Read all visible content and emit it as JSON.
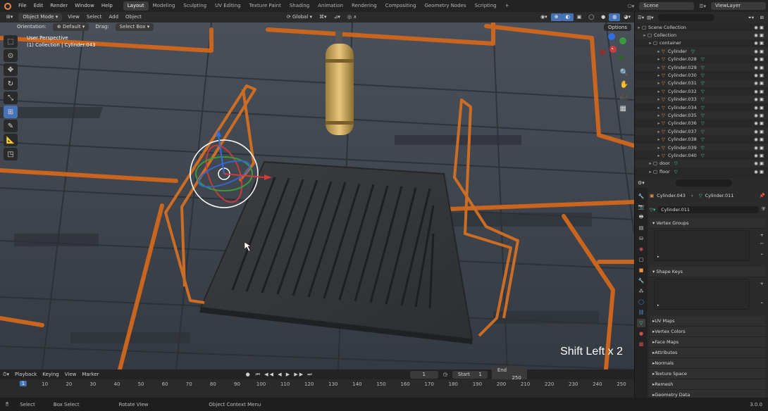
{
  "topbar": {
    "menus": [
      "File",
      "Edit",
      "Render",
      "Window",
      "Help"
    ],
    "workspaces": [
      "Layout",
      "Modeling",
      "Sculpting",
      "UV Editing",
      "Texture Paint",
      "Shading",
      "Animation",
      "Rendering",
      "Compositing",
      "Geometry Nodes",
      "Scripting"
    ],
    "active_workspace": "Layout",
    "add_tab": "+",
    "scene": "Scene",
    "view_layer": "ViewLayer"
  },
  "header": {
    "mode": "Object Mode",
    "menus": [
      "View",
      "Select",
      "Add",
      "Object"
    ],
    "transform": "Global",
    "orientation_label": "Orientation:",
    "orientation_value": "Default",
    "drag_label": "Drag:",
    "drag_value": "Select Box",
    "options": "Options"
  },
  "viewport": {
    "perspective": "User Perspective",
    "collection_info": "(1) Collection | Cylinder.043",
    "overlay_text": "Shift Left x 2"
  },
  "timeline": {
    "menus": [
      "Playback",
      "Keying",
      "View",
      "Marker"
    ],
    "current_frame": "1",
    "start_label": "Start",
    "start": "1",
    "end_label": "End",
    "end": "250",
    "ticks": [
      "1",
      "10",
      "20",
      "30",
      "40",
      "50",
      "60",
      "70",
      "80",
      "90",
      "100",
      "110",
      "120",
      "130",
      "140",
      "150",
      "160",
      "170",
      "180",
      "190",
      "200",
      "210",
      "220",
      "230",
      "240",
      "250"
    ]
  },
  "statusbar": {
    "items": [
      "Select",
      "Box Select",
      "Rotate View",
      "Object Context Menu"
    ],
    "version": "3.0.0"
  },
  "outliner": {
    "root": "Scene Collection",
    "collection": "Collection",
    "container": "container",
    "items": [
      "Cylinder",
      "Cylinder.028",
      "Cylinder.029",
      "Cylinder.030",
      "Cylinder.031",
      "Cylinder.032",
      "Cylinder.033",
      "Cylinder.034",
      "Cylinder.035",
      "Cylinder.036",
      "Cylinder.037",
      "Cylinder.038",
      "Cylinder.039",
      "Cylinder.040"
    ],
    "door": "door",
    "floor": "floor"
  },
  "properties": {
    "breadcrumb_object": "Cylinder.043",
    "breadcrumb_data": "Cylinder.011",
    "mesh_name": "Cylinder.011",
    "sections": {
      "vertex_groups": "Vertex Groups",
      "shape_keys": "Shape Keys",
      "collapsed": [
        "UV Maps",
        "Vertex Colors",
        "Face Maps",
        "Attributes",
        "Normals",
        "Texture Space",
        "Remesh",
        "Geometry Data"
      ]
    }
  },
  "colors": {
    "accent_blue": "#4772b3",
    "orange_pipe": "#d06b24",
    "active_object": "#e4914a",
    "mesh_data": "#4fc2a0"
  }
}
